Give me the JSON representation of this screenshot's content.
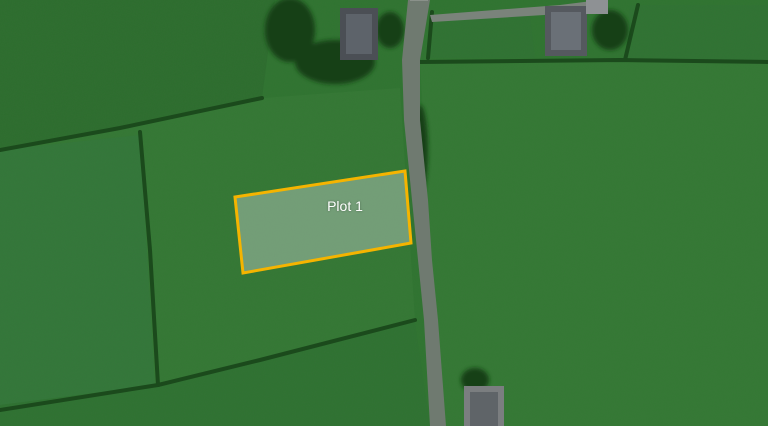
{
  "map": {
    "type": "satellite",
    "plots": [
      {
        "label": "Plot 1",
        "outline_color": "#f5b400",
        "fill_color": "rgba(190,205,200,0.45)"
      }
    ]
  }
}
